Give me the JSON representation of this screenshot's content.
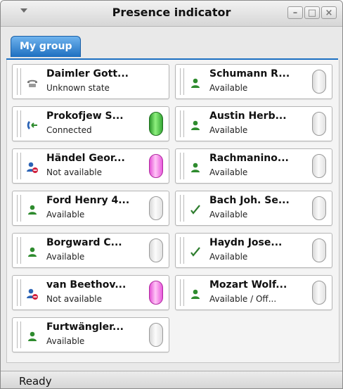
{
  "window": {
    "title": "Presence indicator"
  },
  "tabs": [
    {
      "label": "My group"
    }
  ],
  "status_bar": {
    "text": "Ready"
  },
  "contacts": [
    {
      "name": "Daimler Gott...",
      "status": "Unknown state",
      "icon": "phone-icon",
      "led": "none"
    },
    {
      "name": "Schumann R...",
      "status": "Available",
      "icon": "person-icon",
      "led": "gray"
    },
    {
      "name": "Prokofjew S...",
      "status": "Connected",
      "icon": "call-connected-icon",
      "led": "green"
    },
    {
      "name": "Austin Herb...",
      "status": "Available",
      "icon": "person-icon",
      "led": "gray"
    },
    {
      "name": "Händel Geor...",
      "status": "Not available",
      "icon": "person-unavailable-icon",
      "led": "pink"
    },
    {
      "name": "Rachmanino...",
      "status": "Available",
      "icon": "person-icon",
      "led": "gray"
    },
    {
      "name": "Ford Henry 4...",
      "status": "Available",
      "icon": "person-icon",
      "led": "gray"
    },
    {
      "name": "Bach Joh. Se...",
      "status": "Available",
      "icon": "checkmark-icon",
      "led": "gray"
    },
    {
      "name": "Borgward C...",
      "status": "Available",
      "icon": "person-icon",
      "led": "gray"
    },
    {
      "name": "Haydn Jose...",
      "status": "Available",
      "icon": "checkmark-icon",
      "led": "gray"
    },
    {
      "name": "van Beethov...",
      "status": "Not available",
      "icon": "person-unavailable-icon",
      "led": "pink"
    },
    {
      "name": "Mozart Wolf...",
      "status": "Available / Off...",
      "icon": "person-icon",
      "led": "gray"
    },
    {
      "name": "Furtwängler...",
      "status": "Available",
      "icon": "person-icon",
      "led": "gray"
    }
  ],
  "colors": {
    "accent": "#1e6fc0",
    "available": "#2e8b2e",
    "unavailable": "#d21f3c",
    "led_green": "#3fc43f",
    "led_pink": "#f07ae6"
  }
}
